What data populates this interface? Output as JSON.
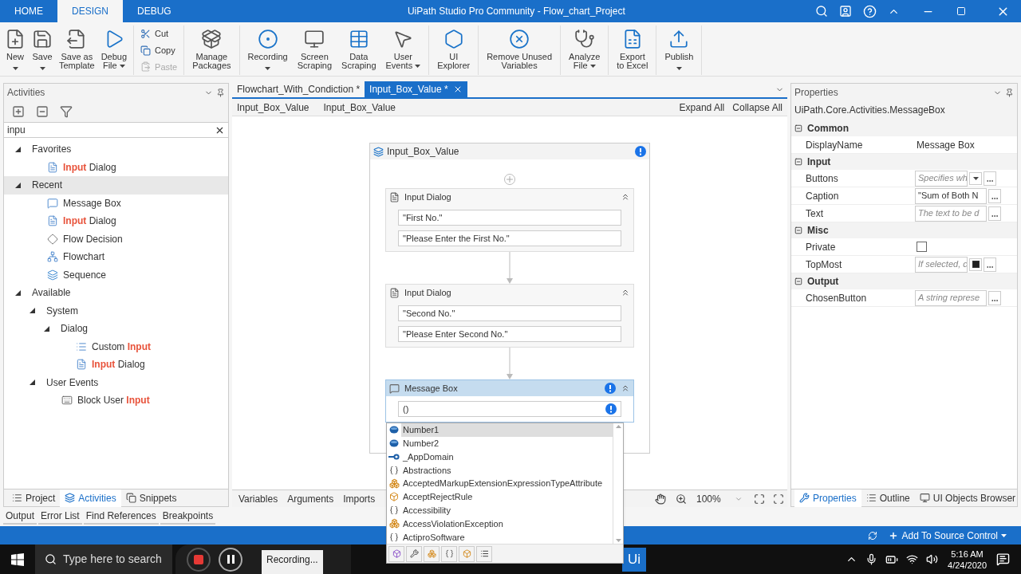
{
  "window": {
    "title": "UiPath Studio Pro Community - Flow_chart_Project"
  },
  "tabs": [
    {
      "label": "HOME",
      "selected": false
    },
    {
      "label": "DESIGN",
      "selected": true
    },
    {
      "label": "DEBUG",
      "selected": false
    }
  ],
  "ribbon": {
    "file_group": [
      {
        "lines": [
          "New"
        ],
        "dropdown": true
      },
      {
        "lines": [
          "Save"
        ],
        "dropdown": true
      },
      {
        "lines": [
          "Save as",
          "Template"
        ],
        "dropdown": false
      },
      {
        "lines": [
          "Debug",
          "File"
        ],
        "dropdown": true
      }
    ],
    "clipboard": [
      {
        "label": "Cut",
        "disabled": false
      },
      {
        "label": "Copy",
        "disabled": false
      },
      {
        "label": "Paste",
        "disabled": true
      }
    ],
    "tool_groups": [
      [
        {
          "lines": [
            "Manage",
            "Packages"
          ],
          "dropdown": false
        }
      ],
      [
        {
          "lines": [
            "Recording"
          ],
          "dropdown": true
        },
        {
          "lines": [
            "Screen",
            "Scraping"
          ],
          "dropdown": false
        },
        {
          "lines": [
            "Data",
            "Scraping"
          ],
          "dropdown": false
        },
        {
          "lines": [
            "User",
            "Events"
          ],
          "dropdown": true
        }
      ],
      [
        {
          "lines": [
            "UI",
            "Explorer"
          ],
          "dropdown": false
        }
      ],
      [
        {
          "lines": [
            "Remove Unused",
            "Variables"
          ],
          "dropdown": false
        }
      ],
      [
        {
          "lines": [
            "Analyze",
            "File"
          ],
          "dropdown": true
        }
      ],
      [
        {
          "lines": [
            "Export",
            "to Excel"
          ],
          "dropdown": false
        }
      ],
      [
        {
          "lines": [
            "Publish"
          ],
          "dropdown": true
        }
      ]
    ]
  },
  "activities": {
    "title": "Activities",
    "search": "inpu",
    "tree": [
      {
        "parts": [
          {
            "text": "Favorites",
            "match": false
          }
        ],
        "expanded": true,
        "selected": false,
        "children": [
          {
            "parts": [
              {
                "text": "Input",
                "match": true
              },
              {
                "text": " Dialog",
                "match": false
              }
            ],
            "kind": "input-dialog",
            "selected": false
          }
        ]
      },
      {
        "parts": [
          {
            "text": "Recent",
            "match": false
          }
        ],
        "expanded": true,
        "selected": true,
        "children": [
          {
            "parts": [
              {
                "text": "Message Box",
                "match": false
              }
            ],
            "kind": "message-box",
            "selected": false
          },
          {
            "parts": [
              {
                "text": "Input",
                "match": true
              },
              {
                "text": " Dialog",
                "match": false
              }
            ],
            "kind": "input-dialog",
            "selected": false
          },
          {
            "parts": [
              {
                "text": "Flow Decision",
                "match": false
              }
            ],
            "kind": "flow-decision",
            "selected": false
          },
          {
            "parts": [
              {
                "text": "Flowchart",
                "match": false
              }
            ],
            "kind": "flowchart",
            "selected": false
          },
          {
            "parts": [
              {
                "text": "Sequence",
                "match": false
              }
            ],
            "kind": "sequence",
            "selected": false
          }
        ]
      },
      {
        "parts": [
          {
            "text": "Available",
            "match": false
          }
        ],
        "expanded": true,
        "selected": false,
        "children": [
          {
            "parts": [
              {
                "text": "System",
                "match": false
              }
            ],
            "expanded": true,
            "selected": false,
            "children": [
              {
                "parts": [
                  {
                    "text": "Dialog",
                    "match": false
                  }
                ],
                "expanded": true,
                "selected": false,
                "children": [
                  {
                    "parts": [
                      {
                        "text": "Custom ",
                        "match": false
                      },
                      {
                        "text": "Input",
                        "match": true
                      }
                    ],
                    "kind": "custom-input",
                    "selected": false
                  },
                  {
                    "parts": [
                      {
                        "text": "Input",
                        "match": true
                      },
                      {
                        "text": " Dialog",
                        "match": false
                      }
                    ],
                    "kind": "input-dialog",
                    "selected": false
                  }
                ]
              }
            ]
          },
          {
            "parts": [
              {
                "text": "User Events",
                "match": false
              }
            ],
            "expanded": true,
            "selected": false,
            "children": [
              {
                "parts": [
                  {
                    "text": "Block User ",
                    "match": false
                  },
                  {
                    "text": "Input",
                    "match": true
                  }
                ],
                "kind": "block-input",
                "selected": false
              }
            ]
          }
        ]
      }
    ],
    "bottom_tabs": [
      {
        "label": "Project",
        "selected": false
      },
      {
        "label": "Activities",
        "selected": true
      },
      {
        "label": "Snippets",
        "selected": false
      }
    ]
  },
  "documents": [
    {
      "label": "Flowchart_With_Condiction *",
      "selected": false
    },
    {
      "label": "Input_Box_Value *",
      "selected": true
    }
  ],
  "breadcrumb": [
    "Input_Box_Value",
    "Input_Box_Value"
  ],
  "expand_all": "Expand All",
  "collapse_all": "Collapse All",
  "sequence": {
    "title": "Input_Box_Value",
    "warning": true,
    "activities": [
      {
        "title": "Input Dialog",
        "kind": "input-dialog",
        "selected": false,
        "warning": false,
        "fields": [
          "\"First No.\"",
          "\"Please Enter the First No.\""
        ]
      },
      {
        "title": "Input Dialog",
        "kind": "input-dialog",
        "selected": false,
        "warning": false,
        "fields": [
          "\"Second No.\"",
          "\"Please Enter Second No.\""
        ]
      },
      {
        "title": "Message Box",
        "kind": "message-box",
        "selected": true,
        "warning": true,
        "fields": [
          "()"
        ]
      }
    ]
  },
  "autocomplete": [
    {
      "label": "Number1",
      "kind": "variable",
      "selected": true
    },
    {
      "label": "Number2",
      "kind": "variable",
      "selected": false
    },
    {
      "label": "_AppDomain",
      "kind": "property",
      "selected": false
    },
    {
      "label": "Abstractions",
      "kind": "namespace",
      "selected": false
    },
    {
      "label": "AcceptedMarkupExtensionExpressionTypeAttribute",
      "kind": "class",
      "selected": false
    },
    {
      "label": "AcceptRejectRule",
      "kind": "enum",
      "selected": false
    },
    {
      "label": "Accessibility",
      "kind": "namespace",
      "selected": false
    },
    {
      "label": "AccessViolationException",
      "kind": "class",
      "selected": false
    },
    {
      "label": "ActiproSoftware",
      "kind": "namespace",
      "selected": false
    }
  ],
  "designer_tabs": [
    "Variables",
    "Arguments",
    "Imports"
  ],
  "zoom": "100%",
  "properties": {
    "title": "Properties",
    "type": "UiPath.Core.Activities.MessageBox",
    "categories": [
      {
        "name": "Common",
        "expanded": true,
        "rows": [
          {
            "name": "DisplayName",
            "kind": "text",
            "value": "Message Box"
          }
        ]
      },
      {
        "name": "Input",
        "expanded": true,
        "rows": [
          {
            "name": "Buttons",
            "kind": "expr-dropdown",
            "placeholder": "Specifies wh"
          },
          {
            "name": "Caption",
            "kind": "expr",
            "value": "\"Sum of Both N"
          },
          {
            "name": "Text",
            "kind": "expr",
            "placeholder": "The text to be d"
          }
        ]
      },
      {
        "name": "Misc",
        "expanded": true,
        "rows": [
          {
            "name": "Private",
            "kind": "checkbox",
            "checked": false
          },
          {
            "name": "TopMost",
            "kind": "expr-check",
            "placeholder": "If selected, c",
            "checked": true
          }
        ]
      },
      {
        "name": "Output",
        "expanded": true,
        "rows": [
          {
            "name": "ChosenButton",
            "kind": "expr",
            "placeholder": "A string represe"
          }
        ]
      }
    ],
    "bottom_tabs": [
      {
        "label": "Properties",
        "selected": true
      },
      {
        "label": "Outline",
        "selected": false
      },
      {
        "label": "UI Objects Browser",
        "selected": false
      }
    ]
  },
  "output_tabs": [
    "Output",
    "Error List",
    "Find References",
    "Breakpoints"
  ],
  "status_bar": {
    "source_control": "Add To Source Control"
  },
  "taskbar": {
    "search_placeholder": "Type here to search",
    "recorder": "Recording...",
    "app": "Ui",
    "time": "5:16 AM",
    "date": "4/24/2020"
  }
}
